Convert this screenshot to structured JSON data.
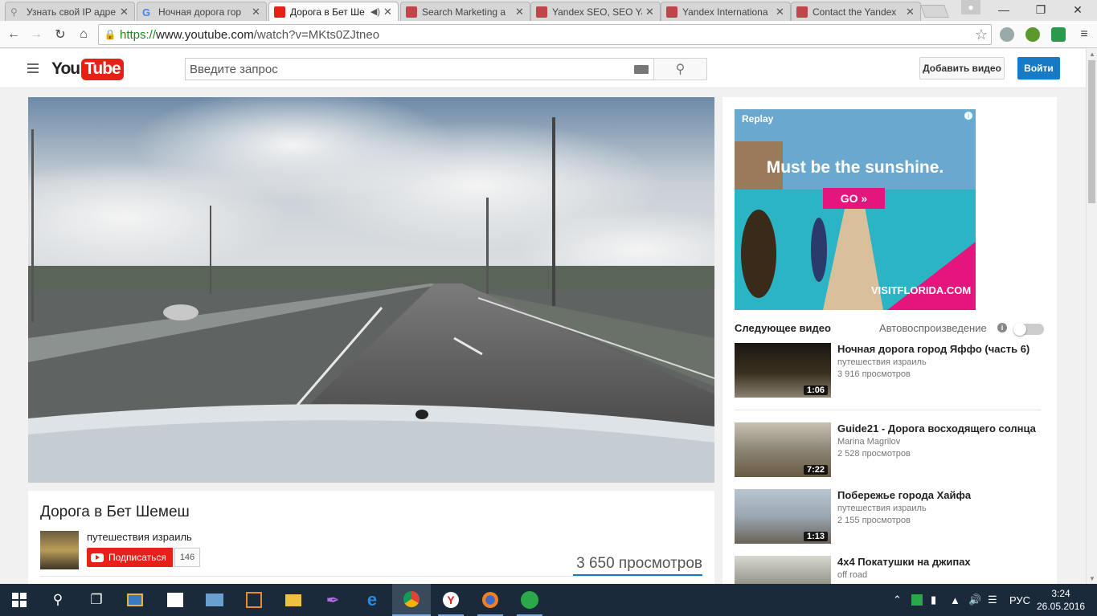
{
  "browser": {
    "tabs": [
      {
        "title": "Узнать свой IP адре",
        "favicon": "search-icon",
        "active": false
      },
      {
        "title": "Ночная дорога гор",
        "favicon": "google-icon",
        "active": false
      },
      {
        "title": "Дорога в Бет Ше",
        "favicon": "youtube-icon",
        "active": true
      },
      {
        "title": "Search Marketing a",
        "favicon": "page-icon",
        "active": false
      },
      {
        "title": "Yandex SEO, SEO Ya",
        "favicon": "page-icon",
        "active": false
      },
      {
        "title": "Yandex Internationa",
        "favicon": "page-icon",
        "active": false
      },
      {
        "title": "Contact the Yandex",
        "favicon": "page-icon",
        "active": false
      }
    ],
    "url_scheme": "https://",
    "url_host": "www.youtube.com",
    "url_path": "/watch?v=MKts0ZJtneo"
  },
  "youtube": {
    "logo_you": "You",
    "logo_tube": "Tube",
    "search_placeholder": "Введите запрос",
    "upload_label": "Добавить видео",
    "signin_label": "Войти"
  },
  "video": {
    "title": "Дорога в Бет Шемеш",
    "channel": "путешествия израиль",
    "subscribe_label": "Подписаться",
    "subscriber_count": "146",
    "views": "3 650 просмотров"
  },
  "ad": {
    "replay": "Replay",
    "headline": "Must be the sunshine.",
    "cta": "GO »",
    "brand": "VISITFLORIDA.COM",
    "info": "i"
  },
  "sidebar": {
    "up_next_label": "Следующее видео",
    "autoplay_label": "Автовоспроизведение",
    "autoplay_on": false,
    "items": [
      {
        "title": "Ночная дорога город Яффо (часть 6)",
        "author": "путешествия израиль",
        "views": "3 916 просмотров",
        "duration": "1:06"
      },
      {
        "title": "Guide21 - Дорога восходящего солнца",
        "author": "Marina Magrilov",
        "views": "2 528 просмотров",
        "duration": "7:22"
      },
      {
        "title": "Побережье города Хайфа",
        "author": "путешествия израиль",
        "views": "2 155 просмотров",
        "duration": "1:13"
      },
      {
        "title": "4x4 Покатушки на джипах",
        "author": "off road",
        "views": "",
        "duration": ""
      }
    ]
  },
  "taskbar": {
    "language": "РУС",
    "time": "3:24",
    "date": "26.05.2016"
  },
  "colors": {
    "youtube_red": "#e62117",
    "signin_blue": "#167ac6",
    "taskbar": "#1b2a3a",
    "ad_pink": "#e6157d"
  }
}
